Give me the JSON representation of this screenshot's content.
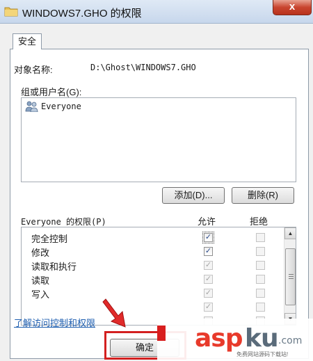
{
  "window": {
    "title": "WINDOWS7.GHO 的权限",
    "close_label": "x"
  },
  "tab": {
    "label": "安全"
  },
  "object": {
    "label": "对象名称:",
    "value": "D:\\Ghost\\WINDOWS7.GHO"
  },
  "groups": {
    "label": "组或用户名(G):",
    "users": [
      {
        "name": "Everyone",
        "icon": "users-icon"
      }
    ]
  },
  "buttons": {
    "add": "添加(D)...",
    "remove": "删除(R)",
    "ok": "确定"
  },
  "permissions": {
    "label": "Everyone 的权限(P)",
    "allow_header": "允许",
    "deny_header": "拒绝",
    "rows": [
      {
        "name": "完全控制",
        "allow": true,
        "deny": false
      },
      {
        "name": "修改",
        "allow": true,
        "deny": false
      },
      {
        "name": "读取和执行",
        "allow": true,
        "deny": false
      },
      {
        "name": "读取",
        "allow": true,
        "deny": false
      },
      {
        "name": "写入",
        "allow": true,
        "deny": false
      },
      {
        "name": "",
        "allow": true,
        "deny": false
      },
      {
        "name": "",
        "allow": false,
        "deny": false
      }
    ]
  },
  "help_link": "了解访问控制和权限",
  "watermark": {
    "asp": "asp",
    "ku": "ku",
    "com": ".com",
    "tagline": "免费网站源码下载站!"
  },
  "colors": {
    "highlight_red": "#d32020",
    "link_blue": "#1f5fb0",
    "watermark_red": "#e83a2b"
  }
}
